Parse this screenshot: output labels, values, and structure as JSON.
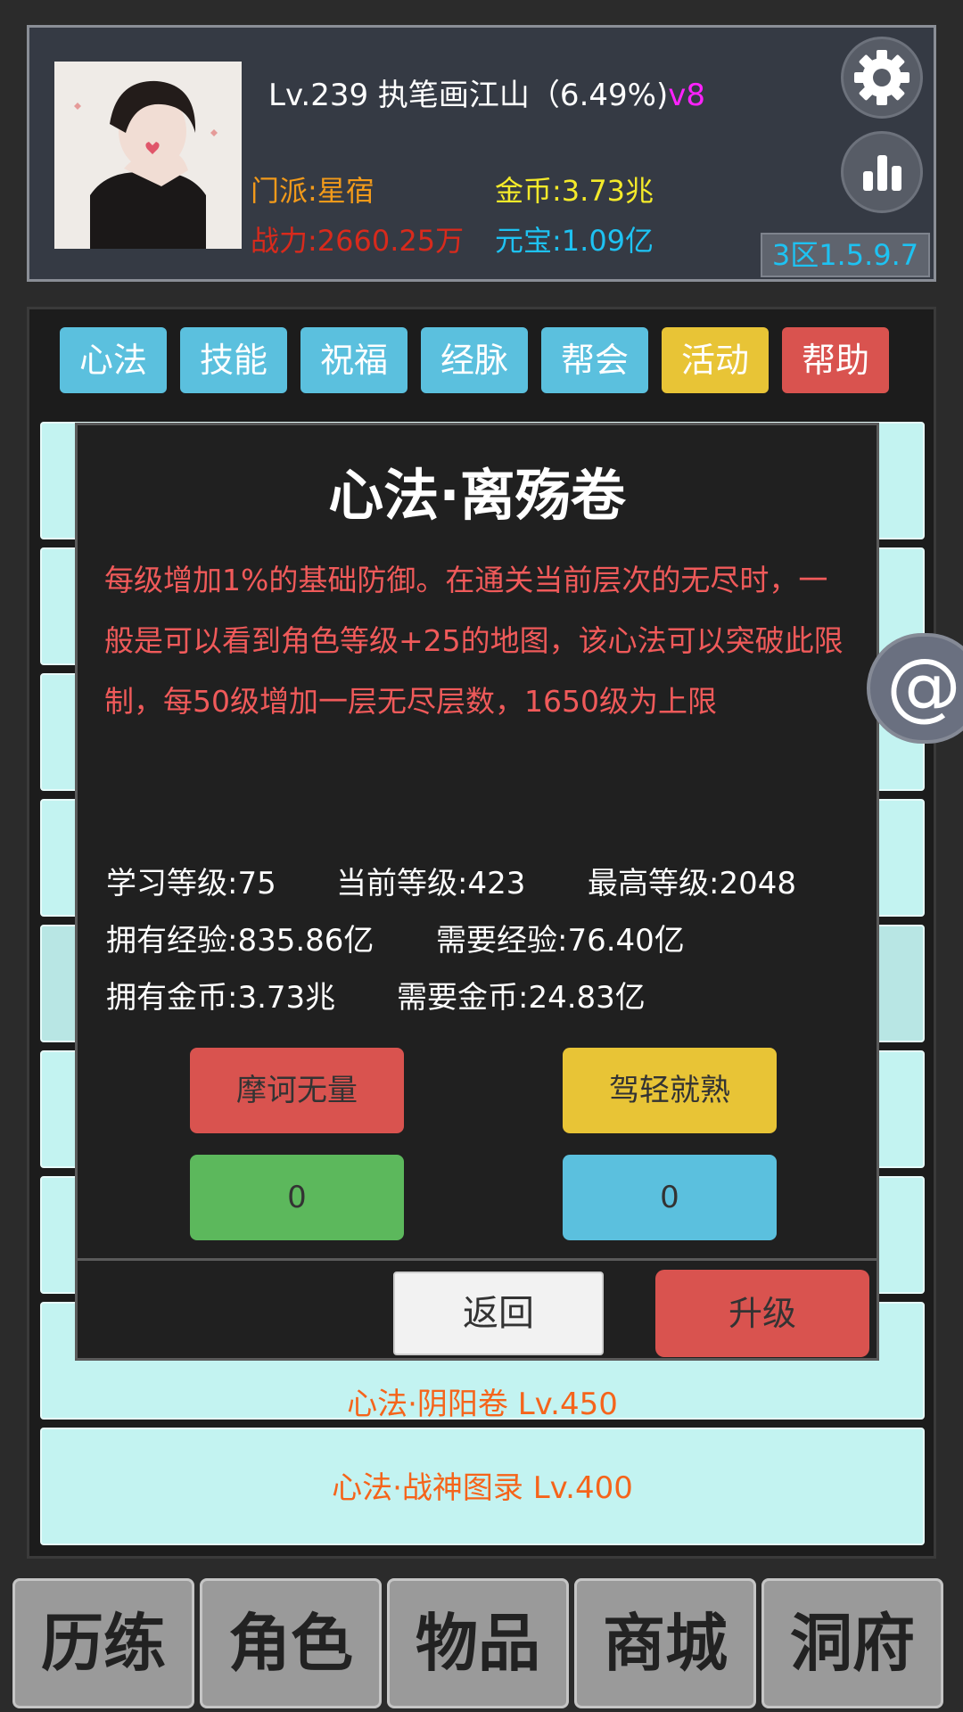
{
  "player": {
    "level_name": "Lv.239 执笔画江山（6.49%)",
    "vip": "v8",
    "sect": "门派:星宿",
    "gold": "金币:3.73兆",
    "power": "战力:2660.25万",
    "yuanbao": "元宝:1.09亿",
    "server": "3区1.5.9.7"
  },
  "tabs": [
    {
      "label": "心法",
      "color": "#5bc0de"
    },
    {
      "label": "技能",
      "color": "#5bc0de"
    },
    {
      "label": "祝福",
      "color": "#5bc0de"
    },
    {
      "label": "经脉",
      "color": "#5bc0de"
    },
    {
      "label": "帮会",
      "color": "#5bc0de"
    },
    {
      "label": "活动",
      "color": "#e8c436"
    },
    {
      "label": "帮助",
      "color": "#d9534f"
    }
  ],
  "list": {
    "item_partial": "心法·阴阳卷 Lv.450",
    "item_last": "心法·战神图录 Lv.400"
  },
  "dialog": {
    "title": "心法·离殇卷",
    "description": "每级增加1%的基础防御。在通关当前层次的无尽时，一般是可以看到角色等级+25的地图，该心法可以突破此限制，每50级增加一层无尽层数，1650级为上限",
    "learn_level": "学习等级:75",
    "current_level": "当前等级:423",
    "max_level": "最高等级:2048",
    "own_exp": "拥有经验:835.86亿",
    "need_exp": "需要经验:76.40亿",
    "own_gold": "拥有金币:3.73兆",
    "need_gold": "需要金币:24.83亿",
    "buttons": {
      "mohe": "摩诃无量",
      "jiaqing": "驾轻就熟",
      "green_value": "0",
      "cyan_value": "0"
    },
    "back": "返回",
    "upgrade": "升级"
  },
  "nav": [
    "历练",
    "角色",
    "物品",
    "商城",
    "洞府"
  ],
  "icons": {
    "settings": "gear-icon",
    "stats": "bar-chart-icon",
    "contact": "at-icon"
  },
  "colors": {
    "accent_blue": "#5bc0de",
    "accent_yellow": "#e8c436",
    "accent_red": "#d9534f",
    "accent_green": "#5cb85c",
    "list_text": "#f5641b",
    "desc_text": "#f05a5a"
  }
}
